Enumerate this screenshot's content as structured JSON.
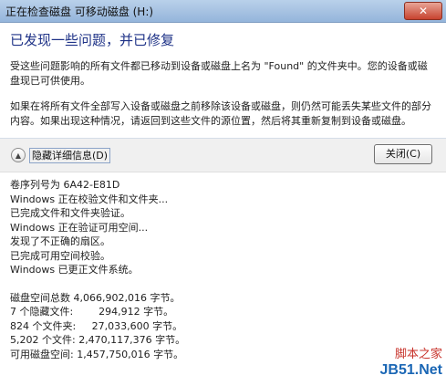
{
  "window": {
    "title": "正在检查磁盘 可移动磁盘 (H:)",
    "close_glyph": "✕"
  },
  "main": {
    "instruction": "已发现一些问题，并已修复",
    "paragraph1": "受这些问题影响的所有文件都已移动到设备或磁盘上名为 \"Found\" 的文件夹中。您的设备或磁盘现已可供使用。",
    "paragraph2": "如果在将所有文件全部写入设备或磁盘之前移除该设备或磁盘，则仍然可能丢失某些文件的部分内容。如果出现这种情况，请返回到这些文件的源位置，然后将其重新复制到设备或磁盘。"
  },
  "footer": {
    "details_toggle_label": "隐藏详细信息(D)",
    "details_toggle_icon": "collapse-chevron-up-icon",
    "close_button_label": "关闭(C)"
  },
  "details": {
    "lines": [
      "卷序列号为 6A42-E81D",
      "Windows 正在校验文件和文件夹...",
      "已完成文件和文件夹验证。",
      "Windows 正在验证可用空间...",
      "发现了不正确的扇区。",
      "已完成可用空间校验。",
      "Windows 已更正文件系统。"
    ],
    "stats": [
      "磁盘空间总数 4,066,902,016 字节。",
      "7 个隐藏文件:        294,912 字节。",
      "824 个文件夹:     27,033,600 字节。",
      "5,202 个文件: 2,470,117,376 字节。",
      "可用磁盘空间: 1,457,750,016 字节。"
    ]
  },
  "watermark": {
    "line1": "脚本之家",
    "line2": "JB51.Net"
  }
}
